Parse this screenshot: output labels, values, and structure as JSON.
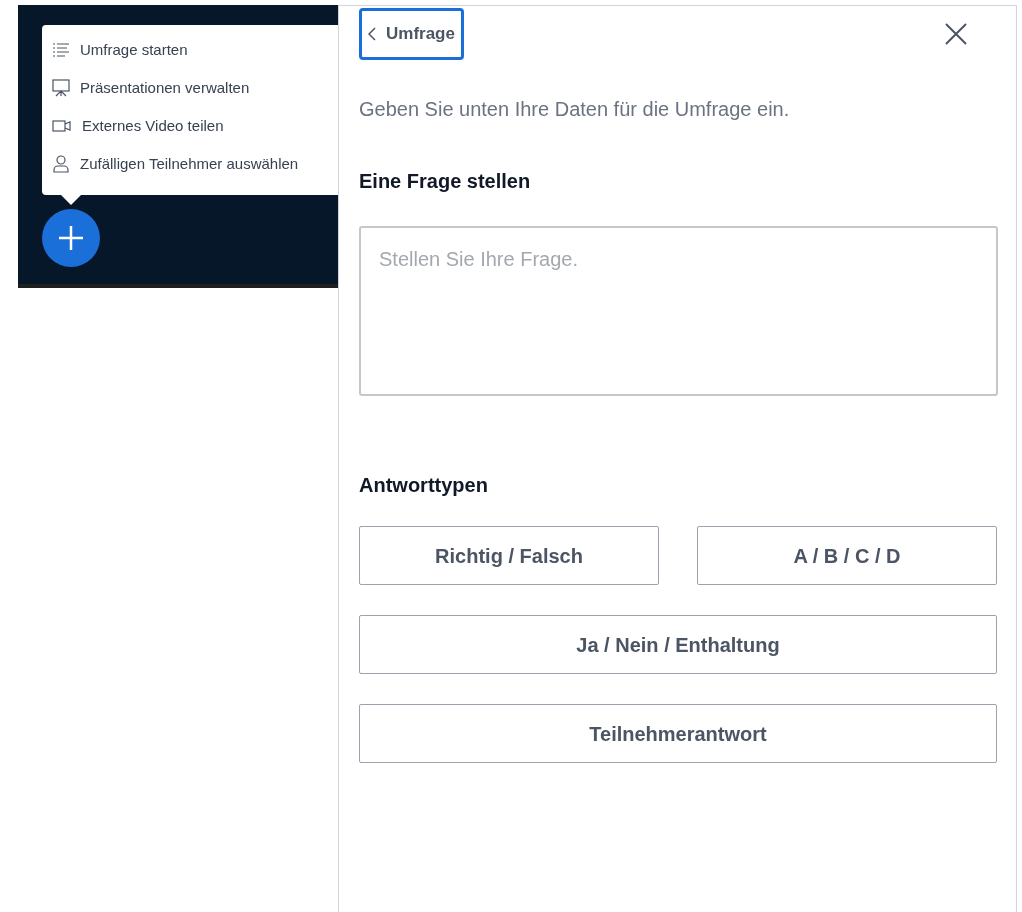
{
  "actions_menu": {
    "items": [
      {
        "label": "Umfrage starten"
      },
      {
        "label": "Präsentationen verwalten"
      },
      {
        "label": "Externes Video teilen"
      },
      {
        "label": "Zufälligen Teilnehmer auswählen"
      }
    ]
  },
  "poll_panel": {
    "back_button": "Umfrage",
    "description": "Geben Sie unten Ihre Daten für die Umfrage ein.",
    "question_heading": "Eine Frage stellen",
    "question_field": {
      "placeholder": "Stellen Sie Ihre Frage."
    },
    "answer_types_heading": "Antworttypen",
    "answer_type_rows": [
      [
        "Richtig / Falsch",
        "A / B / C / D"
      ],
      [
        "Ja / Nein / Enthaltung"
      ],
      [
        "Teilnehmerantwort"
      ]
    ]
  }
}
